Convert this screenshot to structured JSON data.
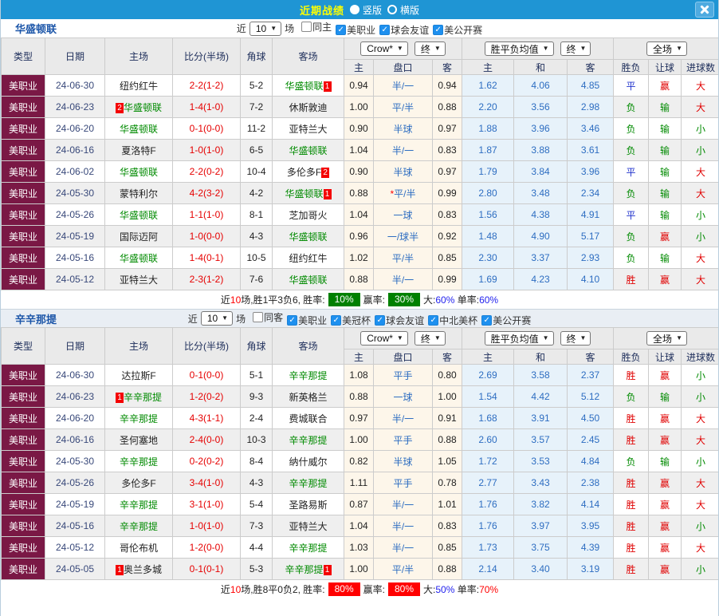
{
  "topbar": {
    "title": "近期战绩",
    "layout_options": [
      {
        "label": "竖版",
        "selected": true
      },
      {
        "label": "横版",
        "selected": false
      }
    ],
    "close_icon": "close-x"
  },
  "colors": {
    "topbar_blue": "#1f95d4",
    "title_yellow": "#ffff00",
    "league_maroon": "#7a1845",
    "focus_team_green": "#008a00",
    "score_red": "#e60000",
    "odds_blue": "#2d6dc1",
    "win_red": "#e00000",
    "draw_blue": "#2133cc",
    "lose_green": "#008a00",
    "badge_green": "#008000",
    "badge_red": "#ff0000"
  },
  "table_head": {
    "left": [
      "类型",
      "日期",
      "主场",
      "比分(半场)",
      "角球",
      "客场"
    ],
    "sub": [
      "主",
      "盘口",
      "客",
      "主",
      "和",
      "客",
      "胜负",
      "让球",
      "进球数"
    ],
    "groups": [
      {
        "selects": [
          {
            "name": "bookmaker-select",
            "value": "Crow*"
          },
          {
            "name": "stage-select",
            "value": "终"
          }
        ]
      },
      {
        "selects": [
          {
            "name": "europe-odds-select",
            "value": "胜平负均值"
          },
          {
            "name": "stage-select",
            "value": "终"
          }
        ]
      },
      {
        "selects": [
          {
            "name": "scope-select",
            "value": "全场"
          }
        ]
      }
    ]
  },
  "sections": [
    {
      "team": "华盛顿联",
      "controls": {
        "near": "近",
        "games": "10",
        "unit": "场",
        "checkboxes": [
          {
            "label": "同主",
            "checked": false
          },
          {
            "label": "美职业",
            "checked": true
          },
          {
            "label": "球会友谊",
            "checked": true
          },
          {
            "label": "美公开赛",
            "checked": true
          }
        ]
      },
      "rows": [
        {
          "league": "美职业",
          "date": "24-06-30",
          "home": {
            "name": "纽约红牛"
          },
          "score": "2-2(1-2)",
          "corner": "5-2",
          "away": {
            "name": "华盛顿联",
            "focus": true,
            "badge_after": "1"
          },
          "asian": [
            "0.94",
            "半/一",
            "0.94"
          ],
          "euro": [
            "1.62",
            "4.06",
            "4.85"
          ],
          "result": "平",
          "let": "赢",
          "goal": "大"
        },
        {
          "league": "美职业",
          "date": "24-06-23",
          "home": {
            "name": "华盛顿联",
            "focus": true,
            "badge_before": "2"
          },
          "score": "1-4(1-0)",
          "corner": "7-2",
          "away": {
            "name": "休斯敦迪"
          },
          "asian": [
            "1.00",
            "平/半",
            "0.88"
          ],
          "euro": [
            "2.20",
            "3.56",
            "2.98"
          ],
          "result": "负",
          "let": "输",
          "goal": "大"
        },
        {
          "league": "美职业",
          "date": "24-06-20",
          "home": {
            "name": "华盛顿联",
            "focus": true
          },
          "score": "0-1(0-0)",
          "corner": "11-2",
          "away": {
            "name": "亚特兰大"
          },
          "asian": [
            "0.90",
            "半球",
            "0.97"
          ],
          "euro": [
            "1.88",
            "3.96",
            "3.46"
          ],
          "result": "负",
          "let": "输",
          "goal": "小"
        },
        {
          "league": "美职业",
          "date": "24-06-16",
          "home": {
            "name": "夏洛特F"
          },
          "score": "1-0(1-0)",
          "corner": "6-5",
          "away": {
            "name": "华盛顿联",
            "focus": true
          },
          "asian": [
            "1.04",
            "半/一",
            "0.83"
          ],
          "euro": [
            "1.87",
            "3.88",
            "3.61"
          ],
          "result": "负",
          "let": "输",
          "goal": "小"
        },
        {
          "league": "美职业",
          "date": "24-06-02",
          "home": {
            "name": "华盛顿联",
            "focus": true
          },
          "score": "2-2(0-2)",
          "corner": "10-4",
          "away": {
            "name": "多伦多F",
            "badge_after": "2"
          },
          "asian": [
            "0.90",
            "半球",
            "0.97"
          ],
          "euro": [
            "1.79",
            "3.84",
            "3.96"
          ],
          "result": "平",
          "let": "输",
          "goal": "大"
        },
        {
          "league": "美职业",
          "date": "24-05-30",
          "home": {
            "name": "蒙特利尔"
          },
          "score": "4-2(3-2)",
          "corner": "4-2",
          "away": {
            "name": "华盛顿联",
            "focus": true,
            "badge_after": "1"
          },
          "asian": [
            "0.88",
            "*平/半",
            "0.99"
          ],
          "euro": [
            "2.80",
            "3.48",
            "2.34"
          ],
          "result": "负",
          "let": "输",
          "goal": "大"
        },
        {
          "league": "美职业",
          "date": "24-05-26",
          "home": {
            "name": "华盛顿联",
            "focus": true
          },
          "score": "1-1(1-0)",
          "corner": "8-1",
          "away": {
            "name": "芝加哥火"
          },
          "asian": [
            "1.04",
            "一球",
            "0.83"
          ],
          "euro": [
            "1.56",
            "4.38",
            "4.91"
          ],
          "result": "平",
          "let": "输",
          "goal": "小"
        },
        {
          "league": "美职业",
          "date": "24-05-19",
          "home": {
            "name": "国际迈阿"
          },
          "score": "1-0(0-0)",
          "corner": "4-3",
          "away": {
            "name": "华盛顿联",
            "focus": true
          },
          "asian": [
            "0.96",
            "一/球半",
            "0.92"
          ],
          "euro": [
            "1.48",
            "4.90",
            "5.17"
          ],
          "result": "负",
          "let": "赢",
          "goal": "小"
        },
        {
          "league": "美职业",
          "date": "24-05-16",
          "home": {
            "name": "华盛顿联",
            "focus": true
          },
          "score": "1-4(0-1)",
          "corner": "10-5",
          "away": {
            "name": "纽约红牛"
          },
          "asian": [
            "1.02",
            "平/半",
            "0.85"
          ],
          "euro": [
            "2.30",
            "3.37",
            "2.93"
          ],
          "result": "负",
          "let": "输",
          "goal": "大"
        },
        {
          "league": "美职业",
          "date": "24-05-12",
          "home": {
            "name": "亚特兰大"
          },
          "score": "2-3(1-2)",
          "corner": "7-6",
          "away": {
            "name": "华盛顿联",
            "focus": true
          },
          "asian": [
            "0.88",
            "半/一",
            "0.99"
          ],
          "euro": [
            "1.69",
            "4.23",
            "4.10"
          ],
          "result": "胜",
          "let": "赢",
          "goal": "大"
        }
      ],
      "footer": {
        "segments": [
          {
            "t": "近"
          },
          {
            "t": "10",
            "c": "red"
          },
          {
            "t": "场,胜1平3负6, 胜率:"
          },
          {
            "t": "10%",
            "badge": "green"
          },
          {
            "t": "赢率:"
          },
          {
            "t": "30%",
            "badge": "green"
          },
          {
            "t": "大:"
          },
          {
            "t": "60%",
            "c": "blue"
          },
          {
            "t": " 单率:"
          },
          {
            "t": "60%",
            "c": "blue"
          }
        ]
      }
    },
    {
      "team": "辛辛那提",
      "controls": {
        "near": "近",
        "games": "10",
        "unit": "场",
        "checkboxes": [
          {
            "label": "同客",
            "checked": false
          },
          {
            "label": "美职业",
            "checked": true
          },
          {
            "label": "美冠杯",
            "checked": true
          },
          {
            "label": "球会友谊",
            "checked": true
          },
          {
            "label": "中北美杯",
            "checked": true
          },
          {
            "label": "美公开赛",
            "checked": true
          }
        ]
      },
      "rows": [
        {
          "league": "美职业",
          "date": "24-06-30",
          "home": {
            "name": "达拉斯F"
          },
          "score": "0-1(0-0)",
          "corner": "5-1",
          "away": {
            "name": "辛辛那提",
            "focus": true
          },
          "asian": [
            "1.08",
            "平手",
            "0.80"
          ],
          "euro": [
            "2.69",
            "3.58",
            "2.37"
          ],
          "result": "胜",
          "let": "赢",
          "goal": "小"
        },
        {
          "league": "美职业",
          "date": "24-06-23",
          "home": {
            "name": "辛辛那提",
            "focus": true,
            "badge_before": "1"
          },
          "score": "1-2(0-2)",
          "corner": "9-3",
          "away": {
            "name": "新英格兰"
          },
          "asian": [
            "0.88",
            "一球",
            "1.00"
          ],
          "euro": [
            "1.54",
            "4.42",
            "5.12"
          ],
          "result": "负",
          "let": "输",
          "goal": "小"
        },
        {
          "league": "美职业",
          "date": "24-06-20",
          "home": {
            "name": "辛辛那提",
            "focus": true
          },
          "score": "4-3(1-1)",
          "corner": "2-4",
          "away": {
            "name": "费城联合"
          },
          "asian": [
            "0.97",
            "半/一",
            "0.91"
          ],
          "euro": [
            "1.68",
            "3.91",
            "4.50"
          ],
          "result": "胜",
          "let": "赢",
          "goal": "大"
        },
        {
          "league": "美职业",
          "date": "24-06-16",
          "home": {
            "name": "圣何塞地"
          },
          "score": "2-4(0-0)",
          "corner": "10-3",
          "away": {
            "name": "辛辛那提",
            "focus": true
          },
          "asian": [
            "1.00",
            "平手",
            "0.88"
          ],
          "euro": [
            "2.60",
            "3.57",
            "2.45"
          ],
          "result": "胜",
          "let": "赢",
          "goal": "大"
        },
        {
          "league": "美职业",
          "date": "24-05-30",
          "home": {
            "name": "辛辛那提",
            "focus": true
          },
          "score": "0-2(0-2)",
          "corner": "8-4",
          "away": {
            "name": "纳什威尔"
          },
          "asian": [
            "0.82",
            "半球",
            "1.05"
          ],
          "euro": [
            "1.72",
            "3.53",
            "4.84"
          ],
          "result": "负",
          "let": "输",
          "goal": "小"
        },
        {
          "league": "美职业",
          "date": "24-05-26",
          "home": {
            "name": "多伦多F"
          },
          "score": "3-4(1-0)",
          "corner": "4-3",
          "away": {
            "name": "辛辛那提",
            "focus": true
          },
          "asian": [
            "1.11",
            "平手",
            "0.78"
          ],
          "euro": [
            "2.77",
            "3.43",
            "2.38"
          ],
          "result": "胜",
          "let": "赢",
          "goal": "大"
        },
        {
          "league": "美职业",
          "date": "24-05-19",
          "home": {
            "name": "辛辛那提",
            "focus": true
          },
          "score": "3-1(1-0)",
          "corner": "5-4",
          "away": {
            "name": "圣路易斯"
          },
          "asian": [
            "0.87",
            "半/一",
            "1.01"
          ],
          "euro": [
            "1.76",
            "3.82",
            "4.14"
          ],
          "result": "胜",
          "let": "赢",
          "goal": "大"
        },
        {
          "league": "美职业",
          "date": "24-05-16",
          "home": {
            "name": "辛辛那提",
            "focus": true
          },
          "score": "1-0(1-0)",
          "corner": "7-3",
          "away": {
            "name": "亚特兰大"
          },
          "asian": [
            "1.04",
            "半/一",
            "0.83"
          ],
          "euro": [
            "1.76",
            "3.97",
            "3.95"
          ],
          "result": "胜",
          "let": "赢",
          "goal": "小"
        },
        {
          "league": "美职业",
          "date": "24-05-12",
          "home": {
            "name": "哥伦布机"
          },
          "score": "1-2(0-0)",
          "corner": "4-4",
          "away": {
            "name": "辛辛那提",
            "focus": true
          },
          "asian": [
            "1.03",
            "半/一",
            "0.85"
          ],
          "euro": [
            "1.73",
            "3.75",
            "4.39"
          ],
          "result": "胜",
          "let": "赢",
          "goal": "大"
        },
        {
          "league": "美职业",
          "date": "24-05-05",
          "home": {
            "name": "奥兰多城",
            "badge_before": "1"
          },
          "score": "0-1(0-1)",
          "corner": "5-3",
          "away": {
            "name": "辛辛那提",
            "focus": true,
            "badge_after": "1"
          },
          "asian": [
            "1.00",
            "平/半",
            "0.88"
          ],
          "euro": [
            "2.14",
            "3.40",
            "3.19"
          ],
          "result": "胜",
          "let": "赢",
          "goal": "小"
        }
      ],
      "footer": {
        "segments": [
          {
            "t": "近"
          },
          {
            "t": "10",
            "c": "red"
          },
          {
            "t": "场,胜8平0负2, 胜率:"
          },
          {
            "t": "80%",
            "badge": "red"
          },
          {
            "t": "赢率:"
          },
          {
            "t": "80%",
            "badge": "red"
          },
          {
            "t": "大:"
          },
          {
            "t": "50%",
            "c": "blue"
          },
          {
            "t": " 单率:"
          },
          {
            "t": "70%",
            "c": "red"
          }
        ]
      }
    }
  ]
}
